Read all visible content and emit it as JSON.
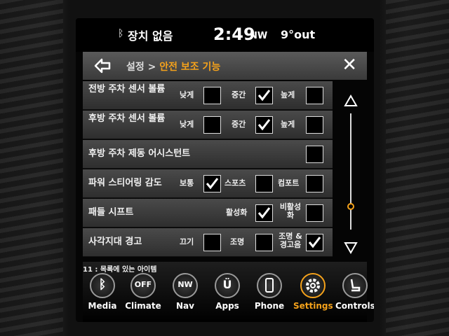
{
  "status": {
    "bt_label": "장치 없음",
    "time": "2:49",
    "direction": "NW",
    "temperature": "9°out"
  },
  "header": {
    "crumb_parent": "설정 > ",
    "crumb_current": "안전 보조 기능"
  },
  "rows": [
    {
      "label": "전방 주차 센서 볼륨",
      "options": [
        "낮게",
        "중간",
        "높게"
      ],
      "checked": [
        false,
        true,
        false
      ]
    },
    {
      "label": "후방 주차 센서 볼륨",
      "options": [
        "낮게",
        "중간",
        "높게"
      ],
      "checked": [
        false,
        true,
        false
      ]
    },
    {
      "label": "후방 주차 제동 어시스턴트",
      "checked": [
        false
      ]
    },
    {
      "label": "파워 스티어링 감도",
      "options": [
        "보통",
        "스포츠",
        "컴포트"
      ],
      "checked": [
        true,
        false,
        false
      ]
    },
    {
      "label": "패들 시프트",
      "options": [
        "활성화",
        "비활성화"
      ],
      "checked": [
        true,
        false
      ]
    },
    {
      "label": "사각지대 경고",
      "options": [
        "끄기",
        "조명",
        "조명 & 경고음"
      ],
      "checked": [
        false,
        false,
        true
      ]
    }
  ],
  "footer": {
    "count": "11 : 목록에 있는 아이템",
    "nav": [
      {
        "label": "Media",
        "icon": "bluetooth-icon"
      },
      {
        "label": "Climate",
        "icon": "off-icon",
        "glyph": "OFF"
      },
      {
        "label": "Nav",
        "icon": "nav-icon",
        "glyph": "NW"
      },
      {
        "label": "Apps",
        "icon": "apps-icon",
        "glyph": "Ü"
      },
      {
        "label": "Phone",
        "icon": "phone-icon"
      },
      {
        "label": "Settings",
        "icon": "gear-icon",
        "active": true
      },
      {
        "label": "Controls",
        "icon": "seat-icon"
      }
    ]
  },
  "colors": {
    "accent": "#f5a21b"
  }
}
